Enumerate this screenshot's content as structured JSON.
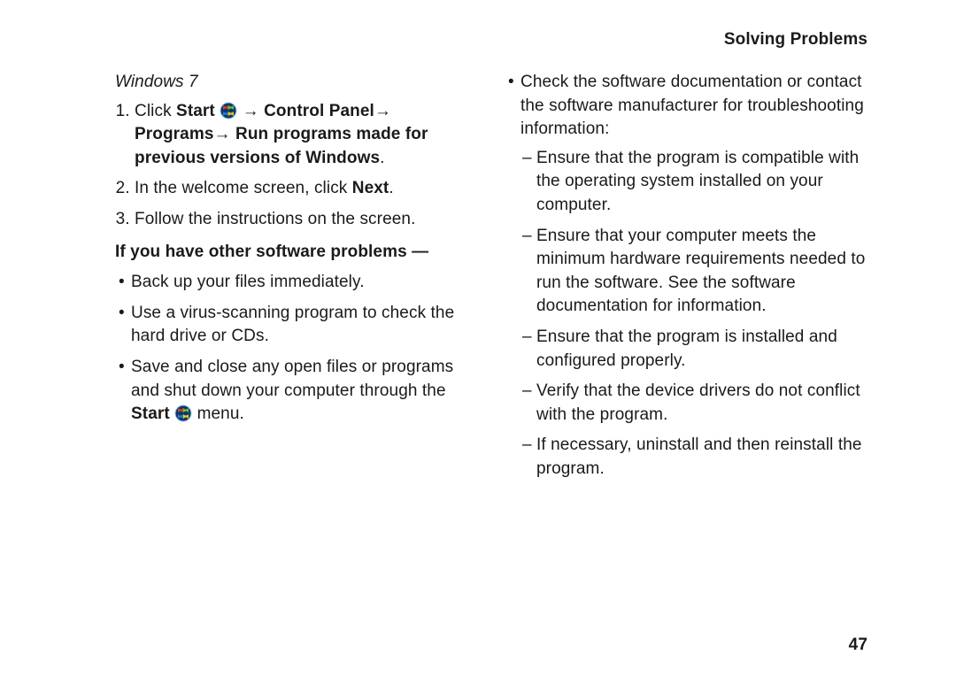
{
  "header": {
    "section_title": "Solving Problems"
  },
  "left": {
    "os_heading": "Windows 7",
    "step1": {
      "pre": "Click ",
      "start": "Start",
      "arrow1": " → ",
      "cp": "Control Panel",
      "arrow2": "→ ",
      "programs": "Programs",
      "arrow3": "→ ",
      "run": "Run programs made for previous versions of Windows",
      "period": "."
    },
    "step2": {
      "pre": "In the welcome screen, click ",
      "next": "Next",
      "period": "."
    },
    "step3": "Follow the instructions on the screen.",
    "subhead": "If you have other software problems —",
    "bullets": {
      "b1": "Back up your files immediately.",
      "b2": "Use a virus-scanning program to check the hard drive or CDs.",
      "b3_pre": "Save and close any open files or programs and shut down your computer through the ",
      "b3_start": "Start",
      "b3_post": " menu."
    }
  },
  "right": {
    "lead": "Check the software documentation or contact the software manufacturer for troubleshooting information:",
    "d1": "Ensure that the program is compatible with the operating system installed on your computer.",
    "d2": "Ensure that your computer meets the minimum hardware requirements needed to run the software. See the software documentation for information.",
    "d3": "Ensure that the program is installed and configured properly.",
    "d4": "Verify that the device drivers do not conflict with the program.",
    "d5": "If necessary, uninstall and then reinstall the program."
  },
  "page_number": "47"
}
